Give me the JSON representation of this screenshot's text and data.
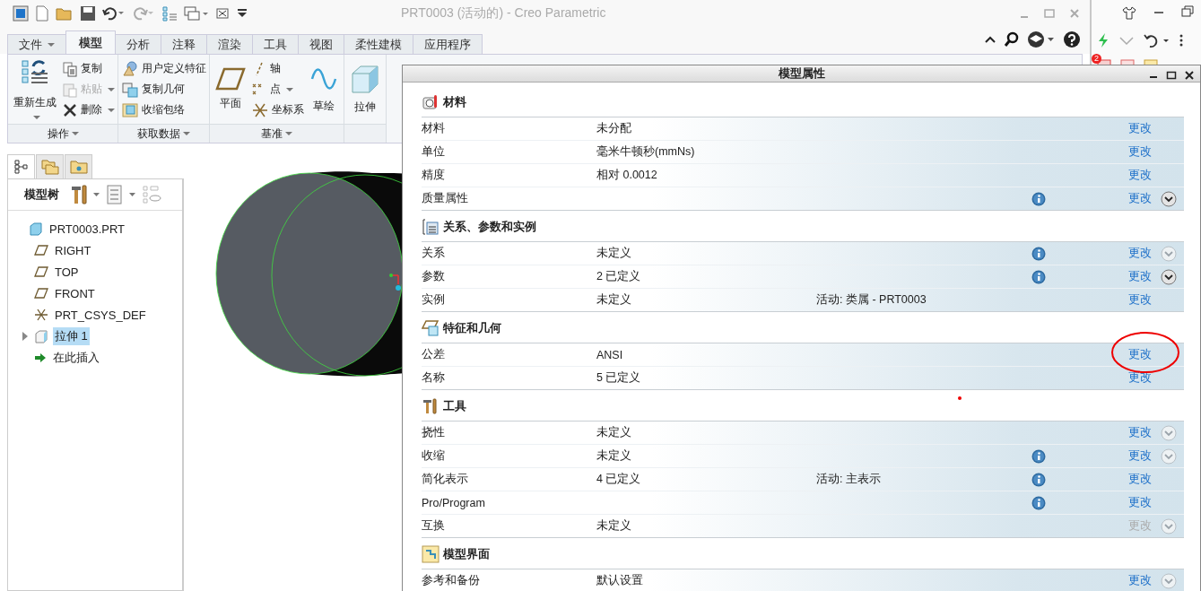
{
  "window": {
    "title": "PRT0003 (活动的) - Creo Parametric"
  },
  "ribbon": {
    "tabs": [
      {
        "label": "文件",
        "selected": false,
        "kind": "menu"
      },
      {
        "label": "模型",
        "selected": true,
        "kind": "tab"
      },
      {
        "label": "分析",
        "selected": false,
        "kind": "tab"
      },
      {
        "label": "注释",
        "selected": false,
        "kind": "tab"
      },
      {
        "label": "渲染",
        "selected": false,
        "kind": "tab"
      },
      {
        "label": "工具",
        "selected": false,
        "kind": "tab"
      },
      {
        "label": "视图",
        "selected": false,
        "kind": "tab"
      },
      {
        "label": "柔性建模",
        "selected": false,
        "kind": "tab"
      },
      {
        "label": "应用程序",
        "selected": false,
        "kind": "tab"
      }
    ],
    "groups": [
      {
        "label": "操作",
        "columns": [
          {
            "kind": "large",
            "items": [
              {
                "label": "重新生成",
                "disabled": false,
                "dropdown": true
              }
            ]
          },
          {
            "kind": "stack",
            "items": [
              {
                "label": "复制",
                "disabled": false,
                "dropdown": false
              },
              {
                "label": "粘贴",
                "disabled": true,
                "dropdown": true
              },
              {
                "label": "删除",
                "disabled": false,
                "dropdown": true
              }
            ]
          }
        ]
      },
      {
        "label": "获取数据",
        "columns": [
          {
            "kind": "stack",
            "items": [
              {
                "label": "用户定义特征",
                "disabled": false,
                "dropdown": false
              },
              {
                "label": "复制几何",
                "disabled": false,
                "dropdown": false
              },
              {
                "label": "收缩包络",
                "disabled": false,
                "dropdown": false
              }
            ]
          }
        ]
      },
      {
        "label": "基准",
        "columns": [
          {
            "kind": "large",
            "items": [
              {
                "label": "平面",
                "disabled": false,
                "dropdown": false
              }
            ]
          },
          {
            "kind": "stack",
            "items": [
              {
                "label": "轴",
                "disabled": false,
                "dropdown": false
              },
              {
                "label": "点",
                "disabled": false,
                "dropdown": true
              },
              {
                "label": "坐标系",
                "disabled": false,
                "dropdown": false
              }
            ]
          },
          {
            "kind": "large",
            "items": [
              {
                "label": "草绘",
                "disabled": false,
                "dropdown": false
              }
            ]
          }
        ]
      },
      {
        "columns": [
          {
            "kind": "large",
            "items": [
              {
                "label": "拉伸",
                "disabled": false,
                "dropdown": false
              }
            ]
          }
        ]
      }
    ]
  },
  "model_tree": {
    "nav_tabs": [
      {
        "selected": true
      },
      {
        "selected": false
      },
      {
        "selected": false
      }
    ],
    "title": "模型树",
    "items": [
      {
        "label": "PRT0003.PRT",
        "kind": "part",
        "selected": false,
        "children": [
          {
            "label": "RIGHT",
            "kind": "plane",
            "selected": false
          },
          {
            "label": "TOP",
            "kind": "plane",
            "selected": false
          },
          {
            "label": "FRONT",
            "kind": "plane",
            "selected": false
          },
          {
            "label": "PRT_CSYS_DEF",
            "kind": "csys",
            "selected": false
          },
          {
            "label": "拉伸 1",
            "kind": "feature",
            "selected": true,
            "expanded": false
          },
          {
            "label": "在此插入",
            "kind": "insert",
            "selected": false
          }
        ]
      }
    ]
  },
  "side_panel": {
    "badge": "2"
  },
  "dialog": {
    "title": "模型属性",
    "sections": [
      {
        "title": "材料",
        "rows": [
          {
            "label": "材料",
            "value": "未分配",
            "info": false,
            "action": "更改",
            "action_disabled": false
          },
          {
            "label": "单位",
            "value": "毫米牛顿秒(mmNs)",
            "info": false,
            "action": "更改",
            "action_disabled": false
          },
          {
            "label": "精度",
            "value": "相对 0.0012",
            "info": false,
            "action": "更改",
            "action_disabled": false
          },
          {
            "label": "质量属性",
            "info": true,
            "action": "更改",
            "action_disabled": false,
            "expander_enabled": true
          }
        ]
      },
      {
        "title": "关系、参数和实例",
        "rows": [
          {
            "label": "关系",
            "value": "未定义",
            "info": true,
            "action": "更改",
            "action_disabled": false,
            "expander_enabled": false
          },
          {
            "label": "参数",
            "value": "2 已定义",
            "info": true,
            "action": "更改",
            "action_disabled": false,
            "expander_enabled": true
          },
          {
            "label": "实例",
            "value": "未定义",
            "extra": "活动: 类属 - PRT0003",
            "info": false,
            "action": "更改",
            "action_disabled": false
          }
        ]
      },
      {
        "title": "特征和几何",
        "rows": [
          {
            "label": "公差",
            "value": "ANSI",
            "info": false,
            "action": "更改",
            "action_disabled": false
          },
          {
            "label": "名称",
            "value": "5 已定义",
            "info": false,
            "action": "更改",
            "action_disabled": false
          }
        ]
      },
      {
        "title": "工具",
        "rows": [
          {
            "label": "挠性",
            "value": "未定义",
            "info": false,
            "action": "更改",
            "action_disabled": false,
            "expander_enabled": false
          },
          {
            "label": "收缩",
            "value": "未定义",
            "info": true,
            "action": "更改",
            "action_disabled": false,
            "expander_enabled": false
          },
          {
            "label": "简化表示",
            "value": "4 已定义",
            "extra": "活动: 主表示",
            "info": true,
            "action": "更改",
            "action_disabled": false
          },
          {
            "label": "Pro/Program",
            "info": true,
            "action": "更改",
            "action_disabled": false
          },
          {
            "label": "互换",
            "value": "未定义",
            "info": false,
            "action": "更改",
            "action_disabled": true,
            "expander_enabled": false
          }
        ]
      },
      {
        "title": "模型界面",
        "rows": [
          {
            "label": "参考和备份",
            "value": "默认设置",
            "info": false,
            "action": "更改",
            "action_disabled": false,
            "expander_enabled": false
          }
        ]
      }
    ]
  }
}
